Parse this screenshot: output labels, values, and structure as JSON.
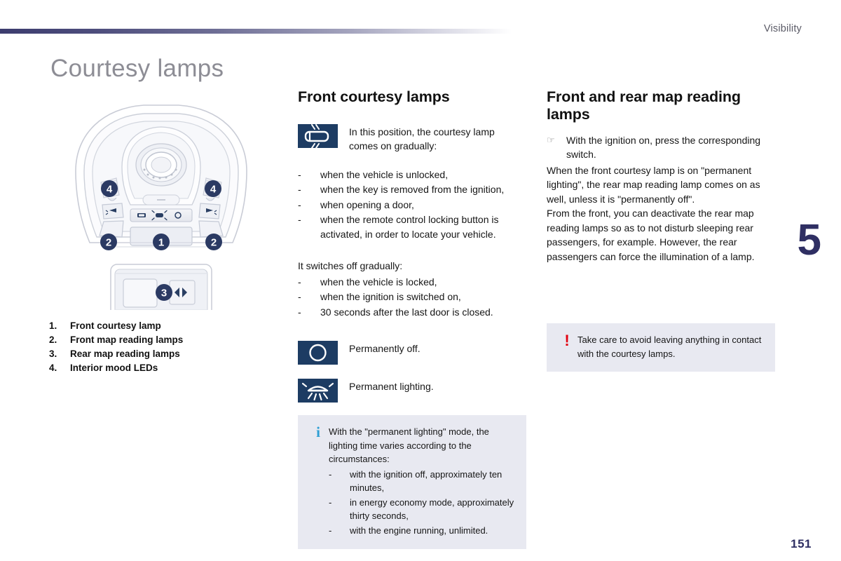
{
  "header": {
    "section": "Visibility",
    "chapter_number": "5",
    "page_number": "151"
  },
  "page_title": "Courtesy lamps",
  "illustration": {
    "callouts": [
      "1",
      "2",
      "2",
      "3",
      "4",
      "4"
    ],
    "legend": [
      {
        "num": "1.",
        "label": "Front courtesy lamp"
      },
      {
        "num": "2.",
        "label": "Front map reading lamps"
      },
      {
        "num": "3.",
        "label": "Rear map reading lamps"
      },
      {
        "num": "4.",
        "label": "Interior mood LEDs"
      }
    ]
  },
  "middle": {
    "heading": "Front courtesy lamps",
    "position_icon_text_line1": "In this position, the courtesy lamp",
    "position_icon_text_line2": "comes on gradually:",
    "comes_on_items": [
      "when the vehicle is unlocked,",
      "when the key is removed from the ignition,",
      "when opening a door,",
      "when the remote control locking button is activated, in order to locate your vehicle."
    ],
    "switches_off_lead": "It switches off gradually:",
    "switches_off_items": [
      "when the vehicle is locked,",
      "when the ignition is switched on,",
      "30 seconds after the last door is closed."
    ],
    "mode_rows": [
      {
        "icon": "lamp-off-icon",
        "label": "Permanently off."
      },
      {
        "icon": "lamp-on-icon",
        "label": "Permanent lighting."
      }
    ],
    "dash_marker": "-"
  },
  "right": {
    "heading": "Front and rear map reading lamps",
    "hand_marker": "☞",
    "hand_text": "With the ignition on, press the corresponding switch.",
    "paragraph1": "When the front courtesy lamp is on \"permanent lighting\", the rear map reading lamp comes on as well, unless it is \"permanently off\".",
    "paragraph2": "From the front, you can deactivate the rear map reading lamps so as to not disturb sleeping rear passengers, for example. However, the rear passengers can force the illumination of a lamp."
  },
  "info_note": {
    "marker": "i",
    "text": "With the \"permanent lighting\" mode, the lighting time varies according to the circumstances:",
    "dash_marker": "-",
    "items": [
      "with the ignition off, approximately ten minutes,",
      "in energy economy mode, approximately thirty seconds,",
      "with the engine running, unlimited."
    ]
  },
  "warning_note": {
    "marker": "!",
    "text": "Take care to avoid leaving anything in contact with the courtesy lamps."
  },
  "colors": {
    "accent_navy": "#2f2f63",
    "icon_navy": "#1d3c63",
    "info_blue": "#2e9fd4",
    "warning_red": "#e2000f",
    "note_bg": "#e8e9f1",
    "title_gray": "#8d8d95"
  }
}
